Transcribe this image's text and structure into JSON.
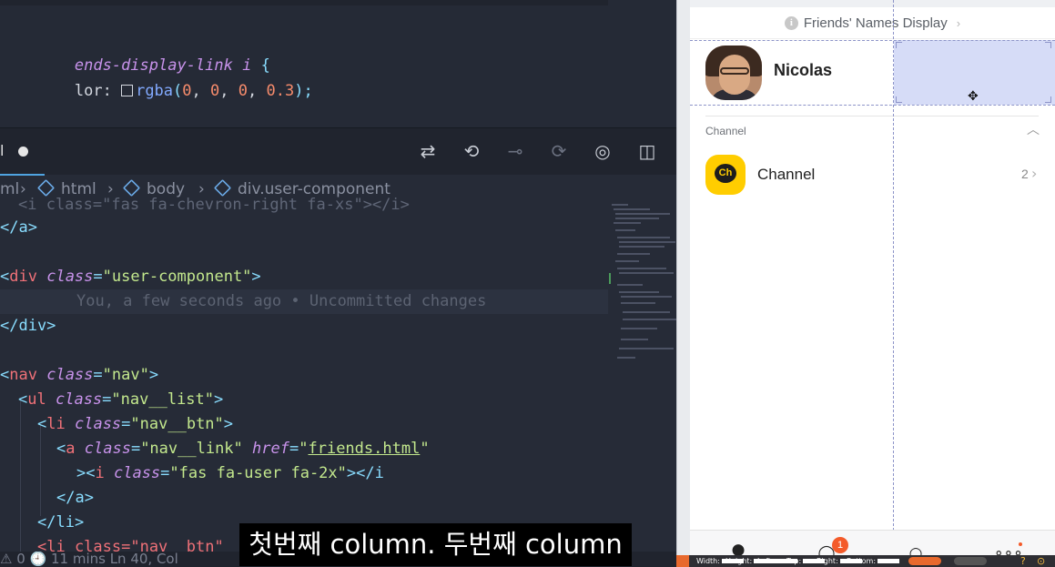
{
  "editor": {
    "top_code": {
      "line1_selector": "ends-display-link i",
      "line1_brace": " {",
      "line2_prop": "lor: ",
      "line2_func": "rgba",
      "line2_args": [
        "0",
        "0",
        "0",
        "0.3"
      ],
      "line2_end": ");"
    },
    "tab": {
      "label": "l"
    },
    "breadcrumb": [
      "ml",
      "html",
      "body",
      "div.user-component"
    ],
    "code_lines": {
      "l0": "<i class=\"fas fa-chevron-right fa-xs\"></i>",
      "l1_close": "</a>",
      "l3_tag": "div",
      "l3_attr": "class",
      "l3_val": "\"user-component\"",
      "blame": "You, a few seconds ago • Uncommitted changes",
      "l5_close": "</div>",
      "l7_tag": "nav",
      "l7_attr": "class",
      "l7_val": "\"nav\"",
      "l8_tag": "ul",
      "l8_attr": "class",
      "l8_val": "\"nav__list\"",
      "l9_tag": "li",
      "l9_attr": "class",
      "l9_val": "\"nav__btn\"",
      "l10_tag": "a",
      "l10_attr": "class",
      "l10_val": "\"nav__link\"",
      "l10_href_attr": "href",
      "l10_href_val": "friends.html",
      "l11_tag": "i",
      "l11_attr": "class",
      "l11_val": "\"fas fa-user fa-2x\"",
      "l11_close": "></i",
      "l12_close": "</a>",
      "l13_close": "</li>",
      "l14_partial": "<li class=\"nav__btn\""
    },
    "status": "⚠ 0    🕘 11 mins    Ln 40, Col"
  },
  "subtitle": "첫번째 column. 두번째 column",
  "preview": {
    "friends_link": "Friends' Names Display",
    "user_name": "Nicolas",
    "channel_section_title": "Channel",
    "channel_label": "Channel",
    "channel_logo_text": "Ch",
    "channel_count": "2",
    "nav_badge": "1"
  },
  "devtools": {
    "width_label": "Width:",
    "height_label": "Height:",
    "left_label": "Left:",
    "top_label": "Top:",
    "right_label": "Right:",
    "bottom_label": "Bottom:"
  },
  "colors": {
    "editor_bg": "#262b37",
    "highlight": "#d6dcf7",
    "kakao_yellow": "#ffcd00",
    "badge": "#f45b2a"
  }
}
